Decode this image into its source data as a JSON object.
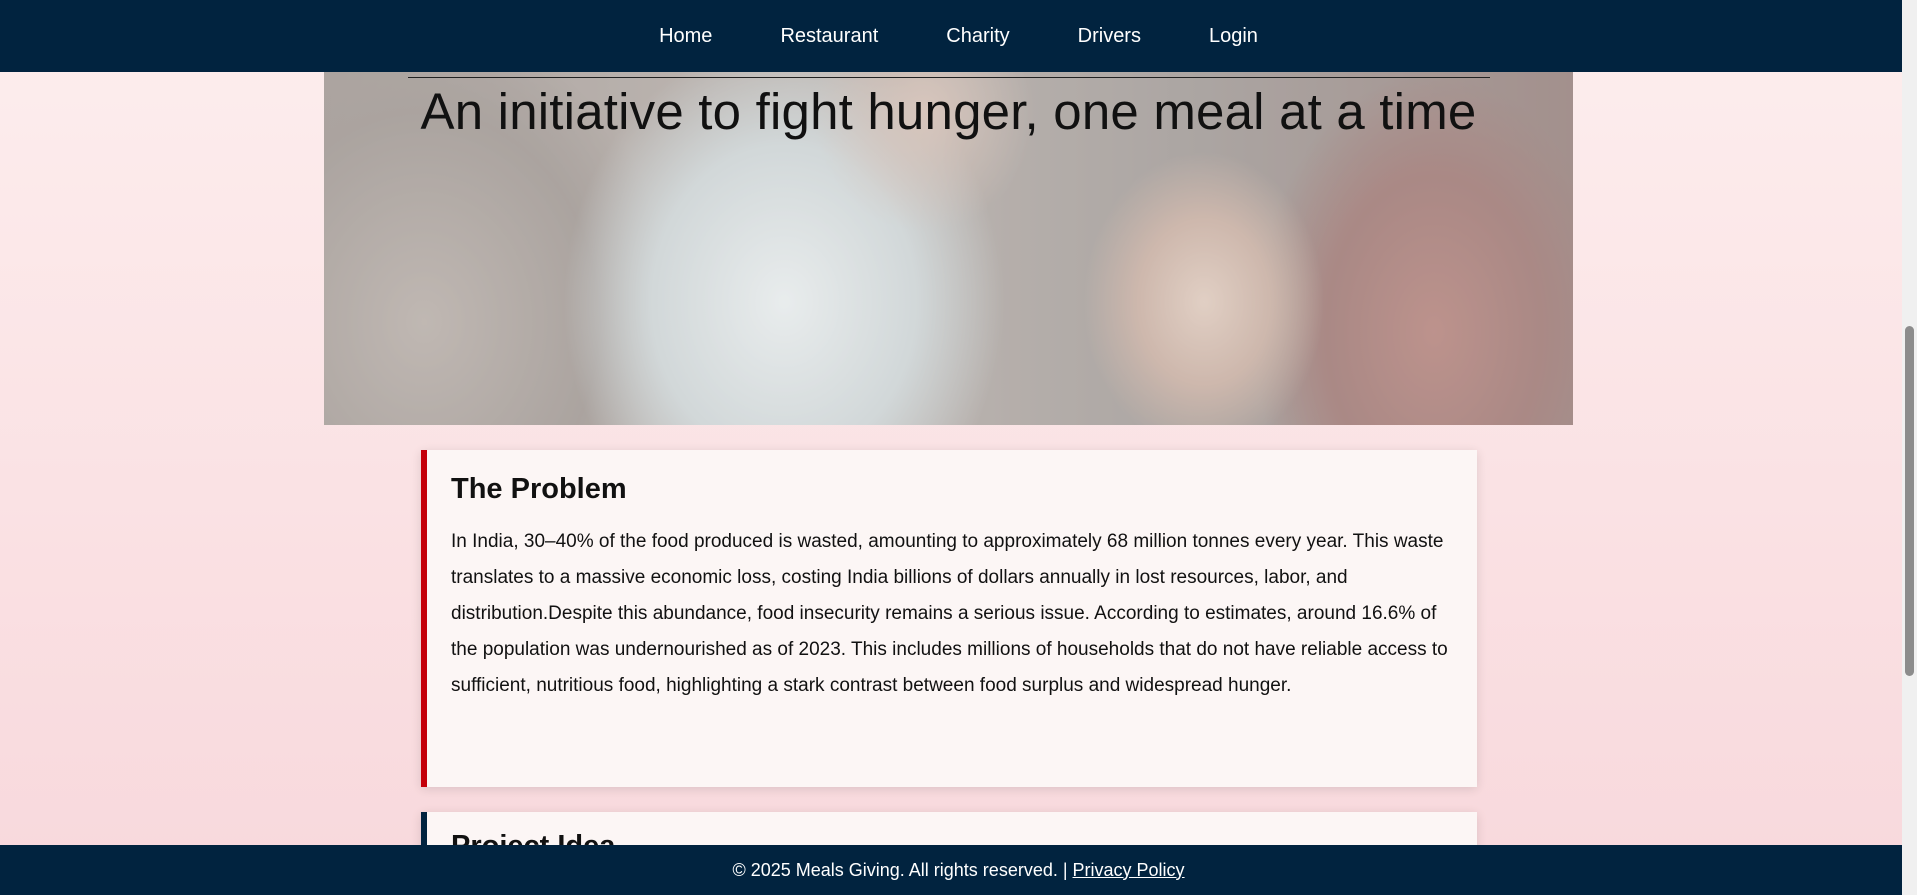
{
  "nav": {
    "items": [
      {
        "label": "Home"
      },
      {
        "label": "Restaurant"
      },
      {
        "label": "Charity"
      },
      {
        "label": "Drivers"
      },
      {
        "label": "Login"
      }
    ]
  },
  "hero": {
    "tagline": "An initiative to fight hunger, one meal at a time"
  },
  "problem": {
    "title": "The Problem",
    "body": "In India, 30–40% of the food produced is wasted, amounting to approximately 68 million tonnes every year. This waste translates to a massive economic loss, costing India billions of dollars annually in lost resources, labor, and distribution.Despite this abundance, food insecurity remains a serious issue. According to estimates, around 16.6% of the population was undernourished as of 2023. This includes millions of households that do not have reliable access to sufficient, nutritious food, highlighting a stark contrast between food surplus and widespread hunger."
  },
  "next_card": {
    "title": "Project Idea"
  },
  "footer": {
    "copyright": "© 2025 Meals Giving. All rights reserved. |",
    "privacy_label": "Privacy Policy"
  },
  "colors": {
    "nav_bg": "#01233f",
    "problem_accent": "#c4000a",
    "next_accent": "#01233f"
  }
}
